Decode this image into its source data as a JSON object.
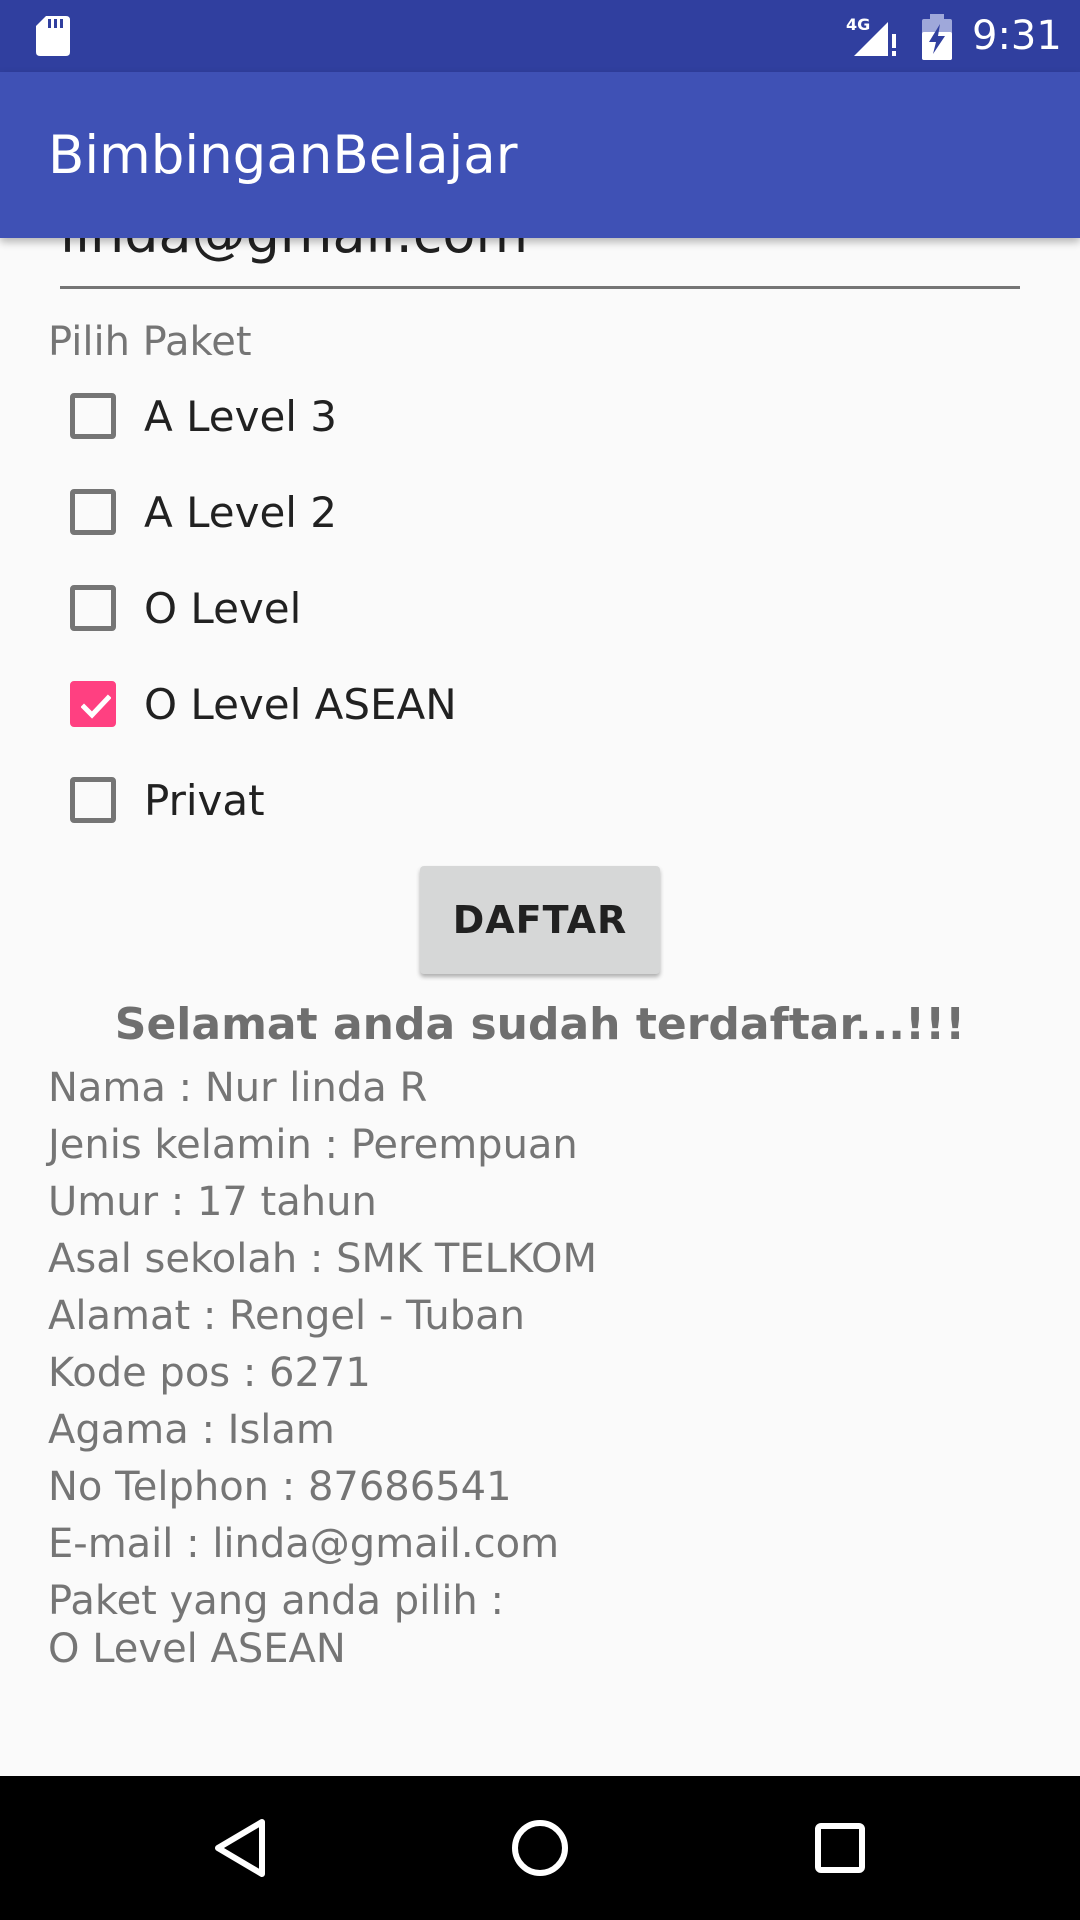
{
  "status_bar": {
    "network": "4G",
    "time": "9:31"
  },
  "app_bar": {
    "title": "BimbinganBelajar"
  },
  "form": {
    "email_value": "linda@gmail.com",
    "package_label": "Pilih Paket",
    "packages": [
      {
        "label": "A Level 3",
        "checked": false
      },
      {
        "label": "A Level 2",
        "checked": false
      },
      {
        "label": "O Level",
        "checked": false
      },
      {
        "label": "O Level ASEAN",
        "checked": true
      },
      {
        "label": "Privat",
        "checked": false
      }
    ],
    "submit_label": "DAFTAR"
  },
  "result": {
    "success_message": "Selamat anda sudah terdaftar...!!!",
    "lines": [
      "Nama : Nur linda R",
      "Jenis kelamin : Perempuan",
      "Umur : 17 tahun",
      "Asal sekolah : SMK TELKOM",
      "Alamat : Rengel - Tuban",
      "Kode pos : 6271",
      "Agama : Islam",
      "No Telphon : 87686541",
      "E-mail : linda@gmail.com",
      "Paket yang anda pilih :",
      "O Level ASEAN"
    ]
  },
  "colors": {
    "status_bar": "#303f9f",
    "app_bar": "#3f51b5",
    "checkbox_accent": "#ff4081",
    "button": "#d6d7d7",
    "nav_bar": "#000000"
  },
  "nav_bar": {
    "icons": [
      "back-icon",
      "home-icon",
      "recents-icon"
    ]
  }
}
